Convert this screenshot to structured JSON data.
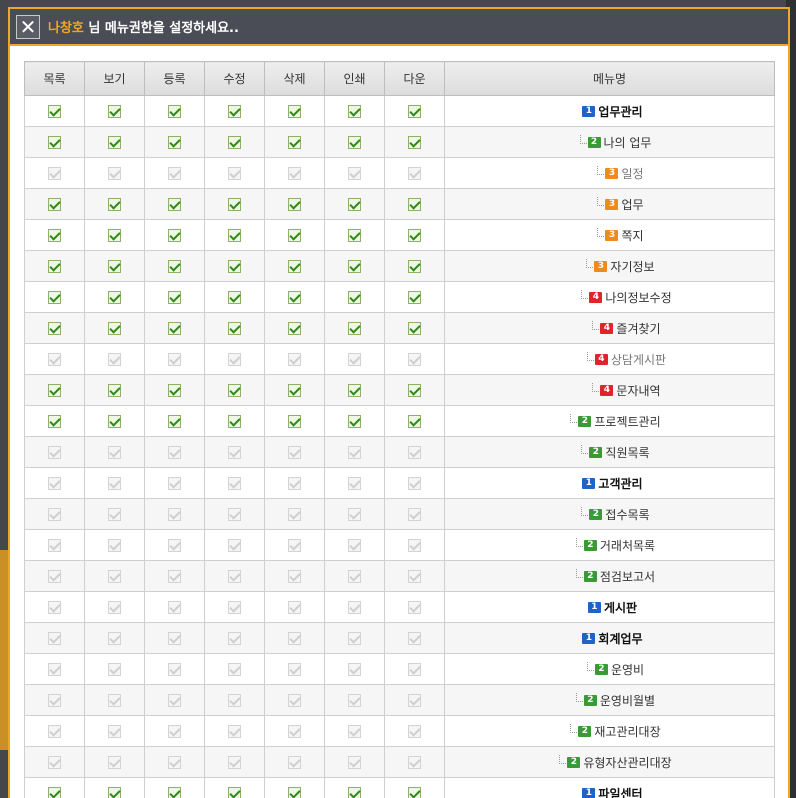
{
  "dialog": {
    "user_name": "나창호",
    "title_suffix": " 님 메뉴권한을 설정하세요..",
    "close_label": "✕"
  },
  "table": {
    "headers": [
      "목록",
      "보기",
      "등록",
      "수정",
      "삭제",
      "인쇄",
      "다운",
      "메뉴명"
    ],
    "rows": [
      {
        "level": 1,
        "name": "업무관리",
        "checks": [
          1,
          1,
          1,
          1,
          1,
          1,
          1
        ]
      },
      {
        "level": 2,
        "name": "나의 업무",
        "checks": [
          1,
          1,
          1,
          1,
          1,
          1,
          1
        ]
      },
      {
        "level": 3,
        "name": "일정",
        "checks": [
          0,
          0,
          0,
          0,
          0,
          0,
          0
        ]
      },
      {
        "level": 3,
        "name": "업무",
        "checks": [
          1,
          1,
          1,
          1,
          1,
          1,
          1
        ]
      },
      {
        "level": 3,
        "name": "쪽지",
        "checks": [
          1,
          1,
          1,
          1,
          1,
          1,
          1
        ]
      },
      {
        "level": 3,
        "name": "자기정보",
        "checks": [
          1,
          1,
          1,
          1,
          1,
          1,
          1
        ]
      },
      {
        "level": 4,
        "name": "나의정보수정",
        "checks": [
          1,
          1,
          1,
          1,
          1,
          1,
          1
        ]
      },
      {
        "level": 4,
        "name": "즐겨찾기",
        "checks": [
          1,
          1,
          1,
          1,
          1,
          1,
          1
        ]
      },
      {
        "level": 4,
        "name": "상담게시판",
        "checks": [
          0,
          0,
          0,
          0,
          0,
          0,
          0
        ]
      },
      {
        "level": 4,
        "name": "문자내역",
        "checks": [
          1,
          1,
          1,
          1,
          1,
          1,
          1
        ]
      },
      {
        "level": 2,
        "name": "프로젝트관리",
        "checks": [
          1,
          1,
          1,
          1,
          1,
          1,
          1
        ]
      },
      {
        "level": 2,
        "name": "직원목록",
        "checks": [
          0,
          0,
          0,
          0,
          0,
          0,
          0
        ]
      },
      {
        "level": 1,
        "name": "고객관리",
        "checks": [
          0,
          0,
          0,
          0,
          0,
          0,
          0
        ]
      },
      {
        "level": 2,
        "name": "접수목록",
        "checks": [
          0,
          0,
          0,
          0,
          0,
          0,
          0
        ]
      },
      {
        "level": 2,
        "name": "거래처목록",
        "checks": [
          0,
          0,
          0,
          0,
          0,
          0,
          0
        ]
      },
      {
        "level": 2,
        "name": "점검보고서",
        "checks": [
          0,
          0,
          0,
          0,
          0,
          0,
          0
        ]
      },
      {
        "level": 1,
        "name": "게시판",
        "checks": [
          0,
          0,
          0,
          0,
          0,
          0,
          0
        ]
      },
      {
        "level": 1,
        "name": "회계업무",
        "checks": [
          0,
          0,
          0,
          0,
          0,
          0,
          0
        ]
      },
      {
        "level": 2,
        "name": "운영비",
        "checks": [
          0,
          0,
          0,
          0,
          0,
          0,
          0
        ]
      },
      {
        "level": 2,
        "name": "운영비월별",
        "checks": [
          0,
          0,
          0,
          0,
          0,
          0,
          0
        ]
      },
      {
        "level": 2,
        "name": "재고관리대장",
        "checks": [
          0,
          0,
          0,
          0,
          0,
          0,
          0
        ]
      },
      {
        "level": 2,
        "name": "유형자산관리대장",
        "checks": [
          0,
          0,
          0,
          0,
          0,
          0,
          0
        ]
      },
      {
        "level": 1,
        "name": "파일센터",
        "checks": [
          1,
          1,
          1,
          1,
          1,
          1,
          1
        ]
      }
    ]
  },
  "colors": {
    "accent": "#f2a623",
    "titlebar": "#4a4d55",
    "level1": "#1f63c6",
    "level2": "#3a9a35",
    "level3": "#f08a1c",
    "level4": "#e0242c"
  }
}
